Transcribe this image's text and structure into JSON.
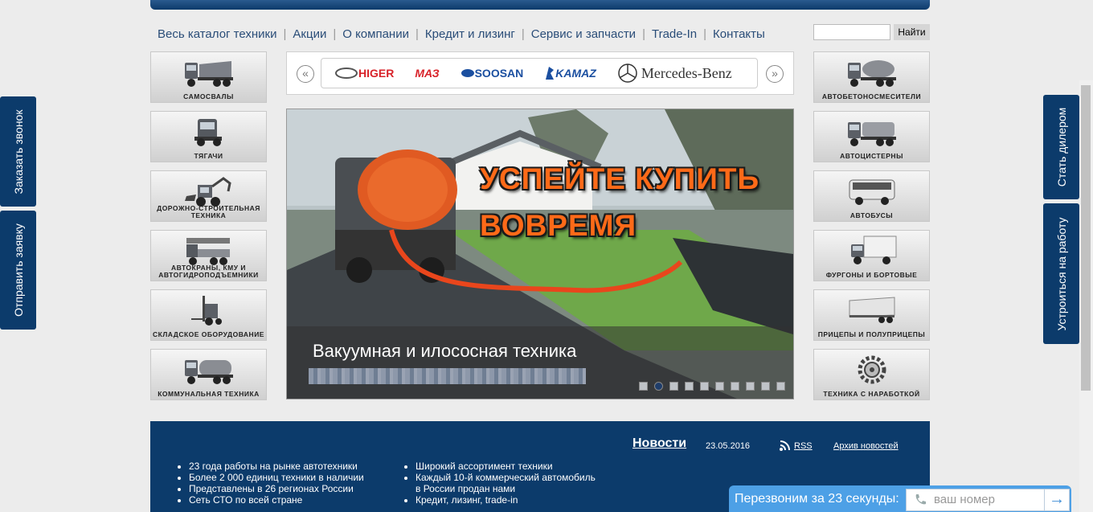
{
  "nav": {
    "items": [
      "Весь каталог техники",
      "Акции",
      "О компании",
      "Кредит и лизинг",
      "Сервис и запчасти",
      "Trade-In",
      "Контакты"
    ],
    "search_button": "Найти"
  },
  "left_categories": [
    {
      "label": "САМОСВАЛЫ",
      "icon": "dump-truck-icon"
    },
    {
      "label": "ТЯГАЧИ",
      "icon": "tractor-unit-icon"
    },
    {
      "label": "ДОРОЖНО-СТРОИТЕЛЬНАЯ ТЕХНИКА",
      "icon": "backhoe-loader-icon"
    },
    {
      "label": "АВТОКРАНЫ, КМУ И АВТОГИДРОПОДЪЕМНИКИ",
      "icon": "truck-crane-icon"
    },
    {
      "label": "СКЛАДСКОЕ ОБОРУДОВАНИЕ",
      "icon": "forklift-icon"
    },
    {
      "label": "КОММУНАЛЬНАЯ ТЕХНИКА",
      "icon": "utility-truck-icon"
    }
  ],
  "right_categories": [
    {
      "label": "АВТОБЕТОНОСМЕСИТЕЛИ",
      "icon": "concrete-mixer-icon"
    },
    {
      "label": "АВТОЦИСТЕРНЫ",
      "icon": "tank-truck-icon"
    },
    {
      "label": "АВТОБУСЫ",
      "icon": "bus-icon"
    },
    {
      "label": "ФУРГОНЫ И БОРТОВЫЕ",
      "icon": "van-truck-icon"
    },
    {
      "label": "ПРИЦЕПЫ И ПОЛУПРИЦЕПЫ",
      "icon": "semitrailer-icon"
    },
    {
      "label": "ТЕХНИКА С НАРАБОТКОЙ",
      "icon": "gear-icon"
    }
  ],
  "brands": [
    "HIGER",
    "МАЗ",
    "SOOSAN",
    "KAMAZ",
    "Mercedes-Benz"
  ],
  "slider": {
    "promo_line1": "УСПЕЙТЕ КУПИТЬ",
    "promo_line2": "ВОВРЕМЯ",
    "caption": "Вакуумная и илососная техника",
    "dots_count": 10,
    "active_dot": 2
  },
  "features_left": [
    "23 года работы на рынке автотехники",
    "Более 2 000 единиц техники в наличии",
    "Представлены в 26 регионах России",
    "Сеть СТО по всей стране"
  ],
  "features_right": [
    "Широкий ассортимент техники",
    "Каждый 10-й коммерческий автомобиль в России продан нами",
    "Кредит, лизинг, trade-in"
  ],
  "news": {
    "title": "Новости",
    "date": "23.05.2016",
    "rss": "RSS",
    "archive": "Архив новостей"
  },
  "side_tabs": {
    "left_top": "Заказать звонок",
    "left_bottom": "Отправить заявку",
    "right_top": "Стать дилером",
    "right_bottom": "Устроиться на работу"
  },
  "callback": {
    "text": "Перезвоним за 23 секунды:",
    "placeholder": "ваш номер"
  },
  "colors": {
    "brand_blue": "#0c3b6b",
    "accent_orange": "#ff6a18",
    "callback_blue": "#4da0e6",
    "maz_red": "#d8232a",
    "kamaz_blue": "#1b4fa0"
  }
}
